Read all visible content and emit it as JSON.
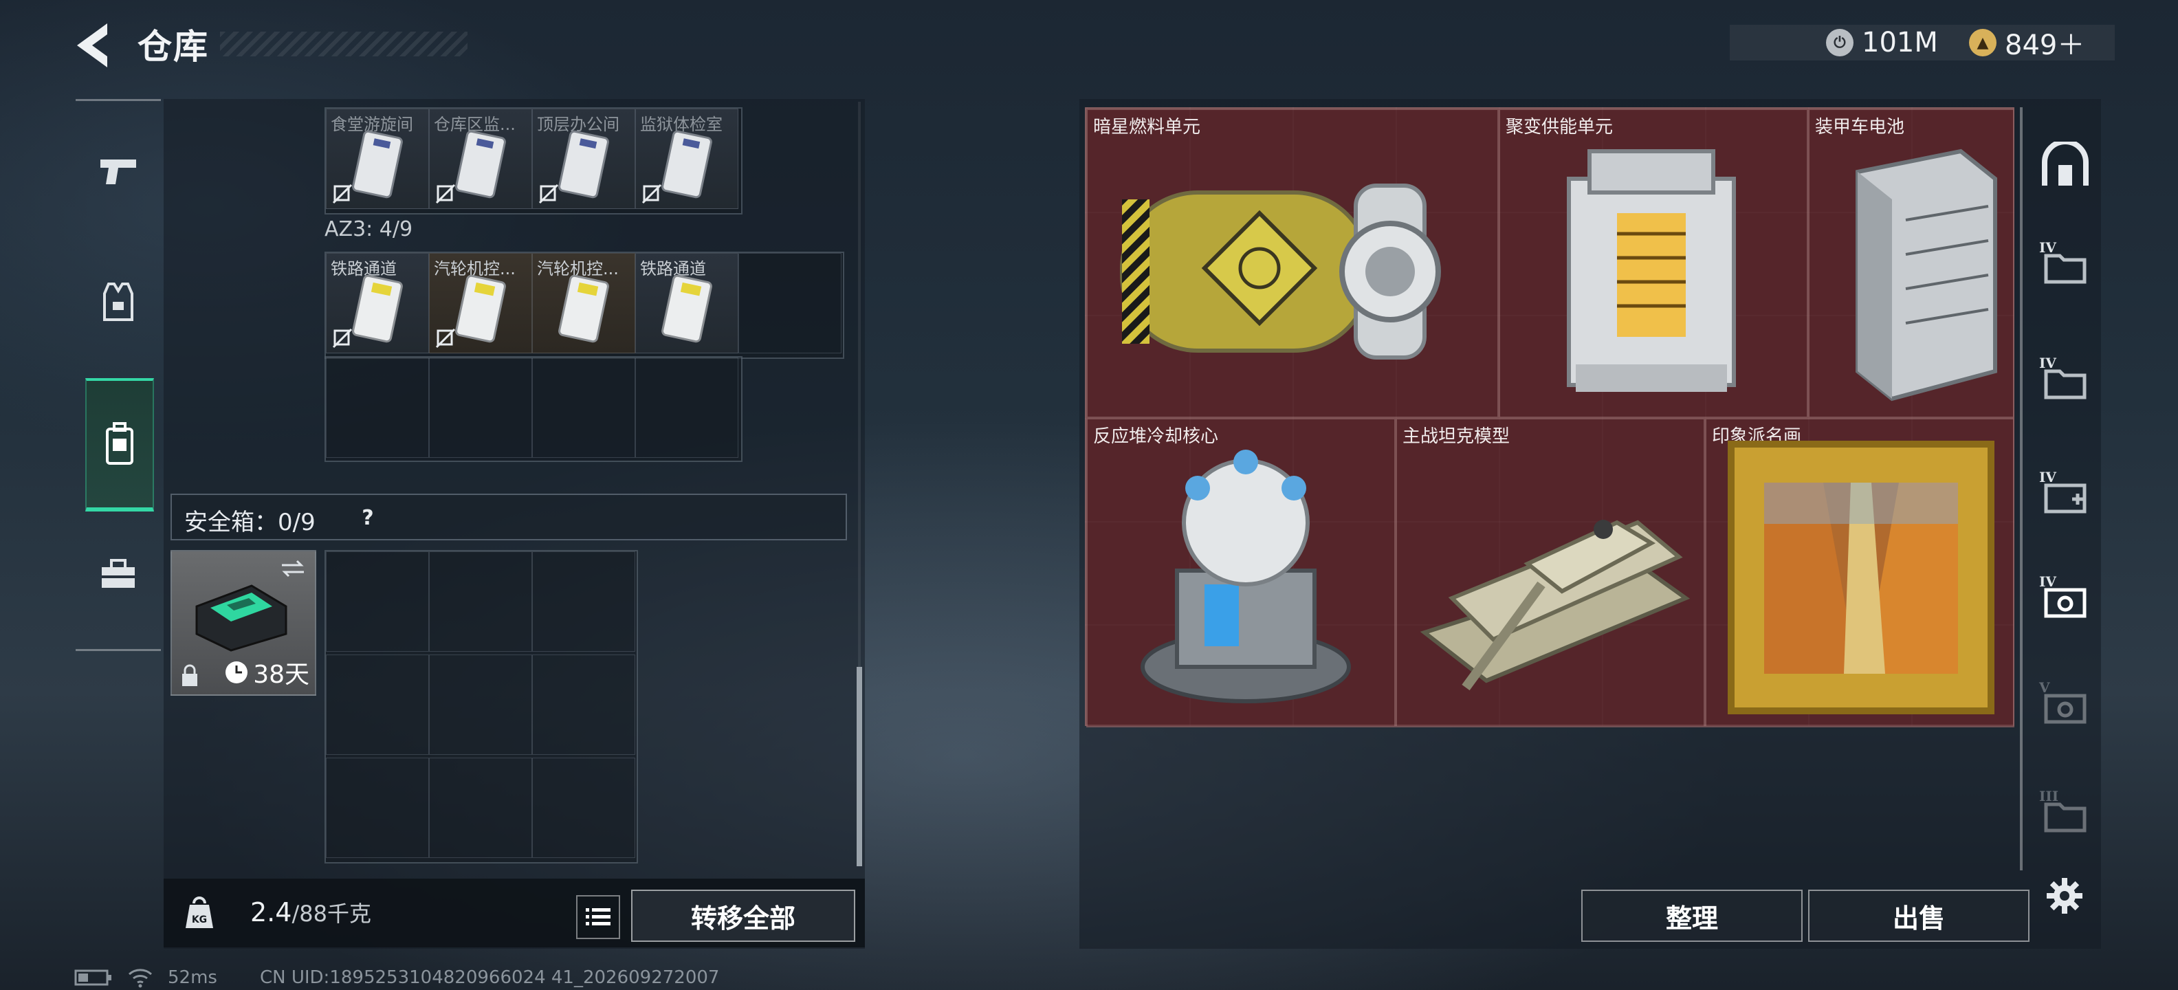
{
  "header": {
    "title": "仓库",
    "currency": [
      {
        "icon": "silver-coin-icon",
        "value": "101M",
        "color": "#c9cdd1"
      },
      {
        "icon": "gold-triangle-coin-icon",
        "value": "849＋",
        "color": "#d8b15a"
      }
    ]
  },
  "left_nav": {
    "items": [
      {
        "name": "weapons",
        "icon": "pistol-icon",
        "active": false
      },
      {
        "name": "armor",
        "icon": "vest-icon",
        "active": false
      },
      {
        "name": "backpack",
        "icon": "backpack-icon",
        "active": true
      },
      {
        "name": "toolbox",
        "icon": "toolbox-icon",
        "active": false
      }
    ]
  },
  "inventory": {
    "upper_row_labels": [
      "食堂游旋间",
      "仓库区监...",
      "顶层办公间",
      "监狱体检室"
    ],
    "az3_label": "AZ3: 4/9",
    "az3_row_labels": [
      "铁路通道",
      "汽轮机控...",
      "汽轮机控...",
      "铁路通道"
    ],
    "safebox_label": "安全箱：0/9",
    "safebox_help": "?",
    "safebox_days": "38天",
    "weight_value": "2.4",
    "weight_cap": "/88千克",
    "transfer_all": "转移全部"
  },
  "stash": {
    "items": [
      {
        "label": "暗星燃料单元",
        "icon": "fuel-canister-icon"
      },
      {
        "label": "聚变供能单元",
        "icon": "fusion-core-icon"
      },
      {
        "label": "装甲车电池",
        "icon": "battery-icon"
      },
      {
        "label": "反应堆冷却核心",
        "icon": "reactor-core-icon"
      },
      {
        "label": "主战坦克模型",
        "icon": "tank-model-icon"
      },
      {
        "label": "印象派名画",
        "icon": "painting-icon"
      }
    ],
    "tiers": [
      "IV",
      "IV",
      "IV",
      "IV",
      "V",
      "III"
    ],
    "sort_label": "整理",
    "sell_label": "出售"
  },
  "status_bar": {
    "latency": "52ms",
    "uid": "CN UID:1895253104820966024 41_202609272007"
  }
}
